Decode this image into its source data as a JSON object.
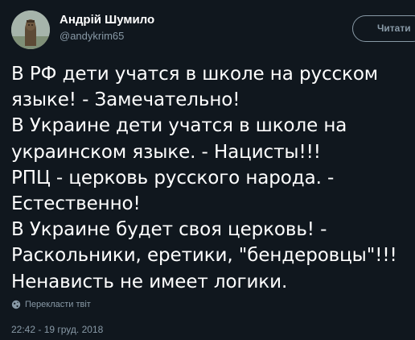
{
  "author": {
    "name": "Андрій Шумило",
    "handle": "@andykrim65",
    "avatar_icon": "avatar-figure-icon"
  },
  "follow_button": {
    "label": "Читати"
  },
  "tweet": {
    "lines": [
      "В РФ дети учатся в школе на русском",
      "языке! - Замечательно!",
      "В Украине дети учатся в школе на",
      "украинском языке. - Нацисты!!!",
      "РПЦ - церковь русского народа. -",
      "Естественно!",
      "В Украине будет своя церковь! -",
      "Раскольники, еретики, \"бендеровцы\"!!!",
      "Ненависть не имеет логики."
    ]
  },
  "translate": {
    "icon": "globe-icon",
    "label": "Перекласти твіт"
  },
  "timestamp": "22:42 - 19 груд. 2018",
  "colors": {
    "background": "#10171e",
    "text": "#ffffff",
    "secondary": "#8899a6"
  }
}
